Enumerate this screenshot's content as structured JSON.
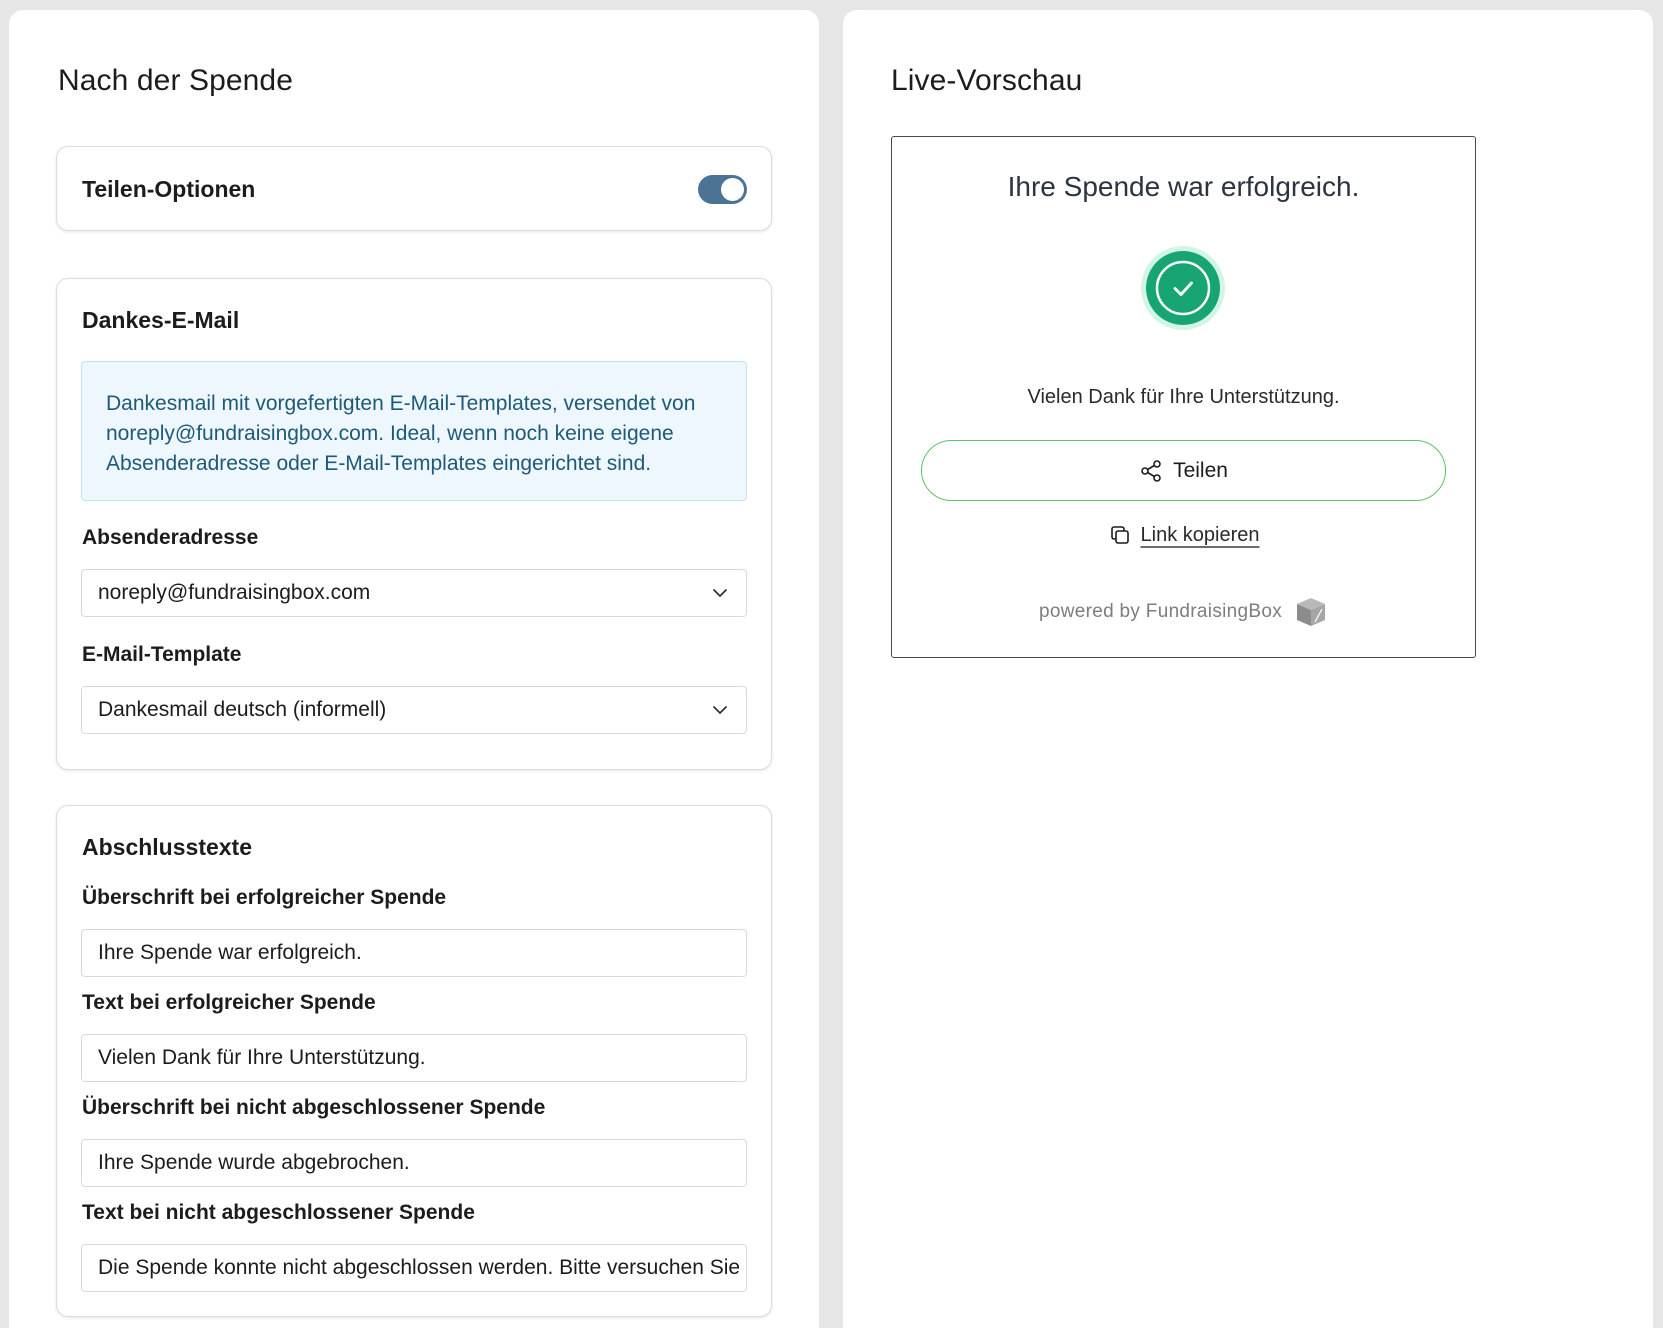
{
  "left_panel": {
    "title": "Nach der Spende",
    "share_card": {
      "heading": "Teilen-Optionen",
      "toggle_on": true
    },
    "email_card": {
      "heading": "Dankes-E-Mail",
      "info": "Dankesmail mit vorgefertigten E-Mail-Templates, versendet von noreply@fundraisingbox.com. Ideal, wenn noch keine eigene Absenderadresse oder E-Mail-Templates eingerichtet sind.",
      "sender_label": "Absenderadresse",
      "sender_value": "noreply@fundraisingbox.com",
      "template_label": "E-Mail-Template",
      "template_value": "Dankesmail deutsch (informell)"
    },
    "texts_card": {
      "heading": "Abschlusstexte",
      "fields": [
        {
          "label": "Überschrift bei erfolgreicher Spende",
          "value": "Ihre Spende war erfolgreich."
        },
        {
          "label": "Text bei erfolgreicher Spende",
          "value": "Vielen Dank für Ihre Unterstützung."
        },
        {
          "label": "Überschrift bei nicht abgeschlossener Spende",
          "value": "Ihre Spende wurde abgebrochen."
        },
        {
          "label": "Text bei nicht abgeschlossener Spende",
          "value": "Die Spende konnte nicht abgeschlossen werden. Bitte versuchen Sie"
        }
      ]
    }
  },
  "right_panel": {
    "title": "Live-Vorschau",
    "preview": {
      "heading": "Ihre Spende war erfolgreich.",
      "success_icon": "check-circle-icon",
      "text": "Vielen Dank für Ihre Unterstützung.",
      "share_label": "Teilen",
      "copy_label": "Link kopieren",
      "powered_by": "powered by FundraisingBox"
    }
  },
  "colors": {
    "toggle_on": "#4a7396",
    "success_green": "#17a673",
    "share_border": "#5cc36b",
    "info_bg": "#eef7fd",
    "info_text": "#1d5a78"
  }
}
